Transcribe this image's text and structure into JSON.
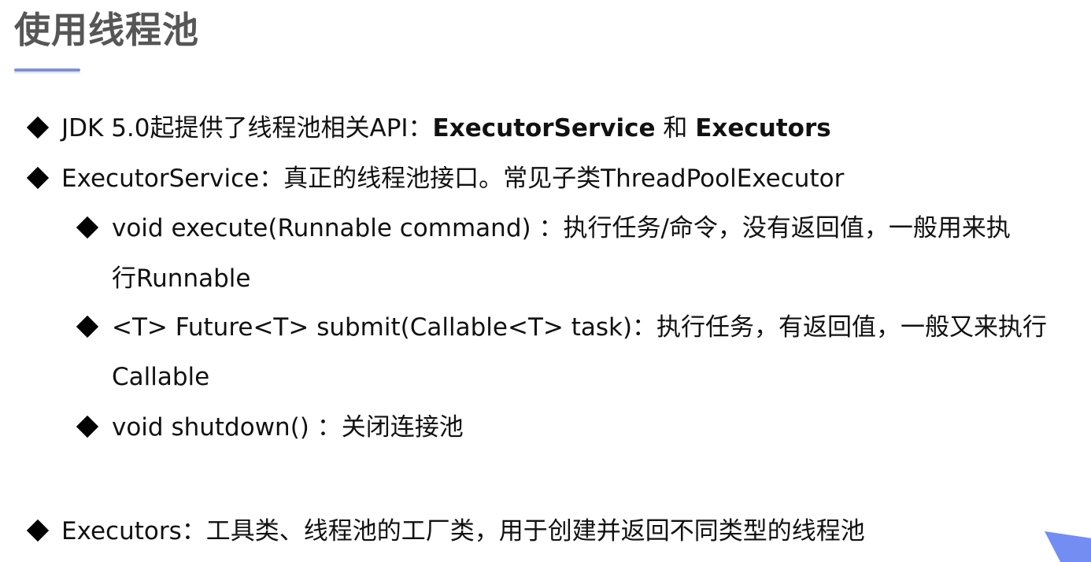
{
  "slide": {
    "title": "使用线程池",
    "bullets": [
      {
        "text_parts": {
          "part1": "JDK 5.0起提供了线程池相关API：",
          "part2": "ExecutorService",
          "part3": " 和 ",
          "part4": "Executors"
        }
      },
      {
        "text": "ExecutorService：真正的线程池接口。常见子类ThreadPoolExecutor"
      },
      {
        "line1": "void execute(Runnable command) ：执行任务/命令，没有返回值，一般用来执",
        "line2": "行Runnable"
      },
      {
        "line1": "<T> Future<T> submit(Callable<T> task)：执行任务，有返回值，一般又来执行",
        "line2": "Callable"
      },
      {
        "text": "void shutdown() ：关闭连接池"
      },
      {
        "text": "Executors：工具类、线程池的工厂类，用于创建并返回不同类型的线程池"
      }
    ],
    "icons": {
      "bullet": "diamond-bullet-icon"
    },
    "colors": {
      "title": "#565656",
      "accent": "#7f8fd1",
      "text": "#111111",
      "corner": "#6c87f2"
    }
  }
}
